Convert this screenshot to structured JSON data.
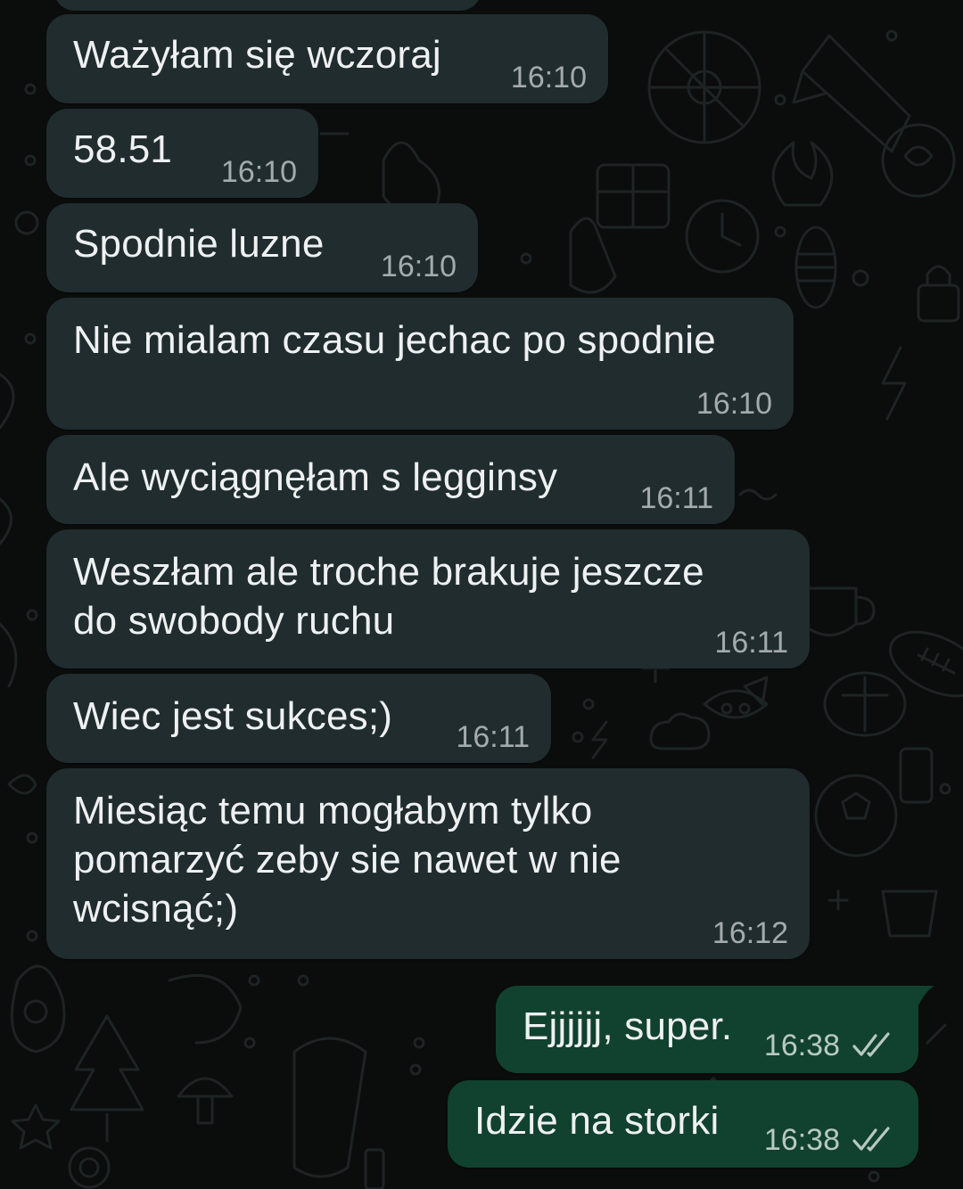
{
  "colors": {
    "background": "#0b0c0c",
    "incoming_bubble": "#202c2e",
    "outgoing_bubble": "#11412f",
    "message_text": "#eef0f1",
    "timestamp": "#a4abad",
    "read_ticks": "#b7c9c0"
  },
  "messages": [
    {
      "direction": "incoming",
      "text": "Ważyłam się wczoraj",
      "time": "16:10"
    },
    {
      "direction": "incoming",
      "text": "58.51",
      "time": "16:10"
    },
    {
      "direction": "incoming",
      "text": "Spodnie luzne",
      "time": "16:10"
    },
    {
      "direction": "incoming",
      "text": "Nie mialam czasu jechac po spodnie",
      "time": "16:10"
    },
    {
      "direction": "incoming",
      "text": "Ale wyciągnęłam s legginsy",
      "time": "16:11"
    },
    {
      "direction": "incoming",
      "text": "Weszłam ale troche brakuje jeszcze\ndo swobody ruchu",
      "time": "16:11"
    },
    {
      "direction": "incoming",
      "text": "Wiec jest sukces;)",
      "time": "16:11"
    },
    {
      "direction": "incoming",
      "text": "Miesiąc temu mogłabym tylko\npomarzyć zeby sie nawet w nie\nwcisnąć;)",
      "time": "16:12"
    },
    {
      "direction": "outgoing",
      "text": "Ejjjjjj, super.",
      "time": "16:38",
      "status_icon": "double-check-icon"
    },
    {
      "direction": "outgoing",
      "text": "Idzie na storki",
      "time": "16:38",
      "status_icon": "double-check-icon"
    }
  ]
}
